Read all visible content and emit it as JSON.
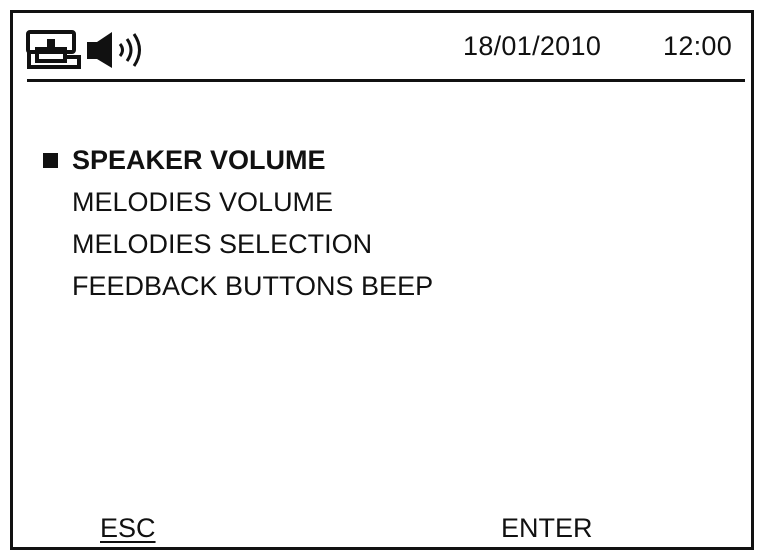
{
  "status_bar": {
    "icons": [
      "phone-line-icon",
      "speaker-volume-icon"
    ],
    "date": "18/01/2010",
    "time": "12:00"
  },
  "menu": {
    "selected_index": 0,
    "items": [
      {
        "label": "SPEAKER VOLUME",
        "selected": true
      },
      {
        "label": "MELODIES VOLUME",
        "selected": false
      },
      {
        "label": "MELODIES SELECTION",
        "selected": false
      },
      {
        "label": "FEEDBACK BUTTONS BEEP",
        "selected": false
      }
    ]
  },
  "softkeys": {
    "esc": "ESC",
    "enter": "ENTER"
  },
  "colors": {
    "foreground": "#111111",
    "background": "#ffffff"
  }
}
